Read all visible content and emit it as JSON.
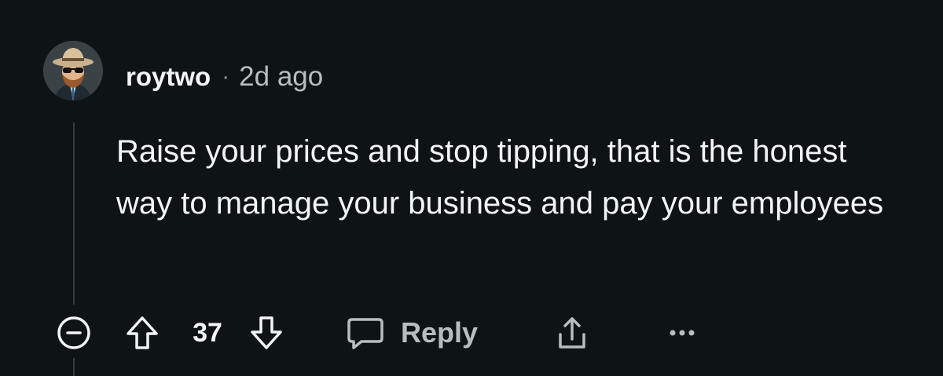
{
  "comment": {
    "username": "roytwo",
    "separator": "·",
    "timestamp": "2d ago",
    "body": "Raise your prices and stop tipping, that is the honest way to manage your business and pay your employees"
  },
  "actions": {
    "vote_count": "37",
    "reply_label": "Reply"
  },
  "icons": {
    "collapse": "minus-circle-icon",
    "upvote": "arrow-up-outline-icon",
    "downvote": "arrow-down-outline-icon",
    "reply": "speech-bubble-icon",
    "share": "share-upload-icon",
    "more": "ellipsis-icon"
  },
  "colors": {
    "background": "#0e1416",
    "text": "#f2f4f5",
    "muted_text": "#b7bec1",
    "thread_line": "#343c3f"
  }
}
